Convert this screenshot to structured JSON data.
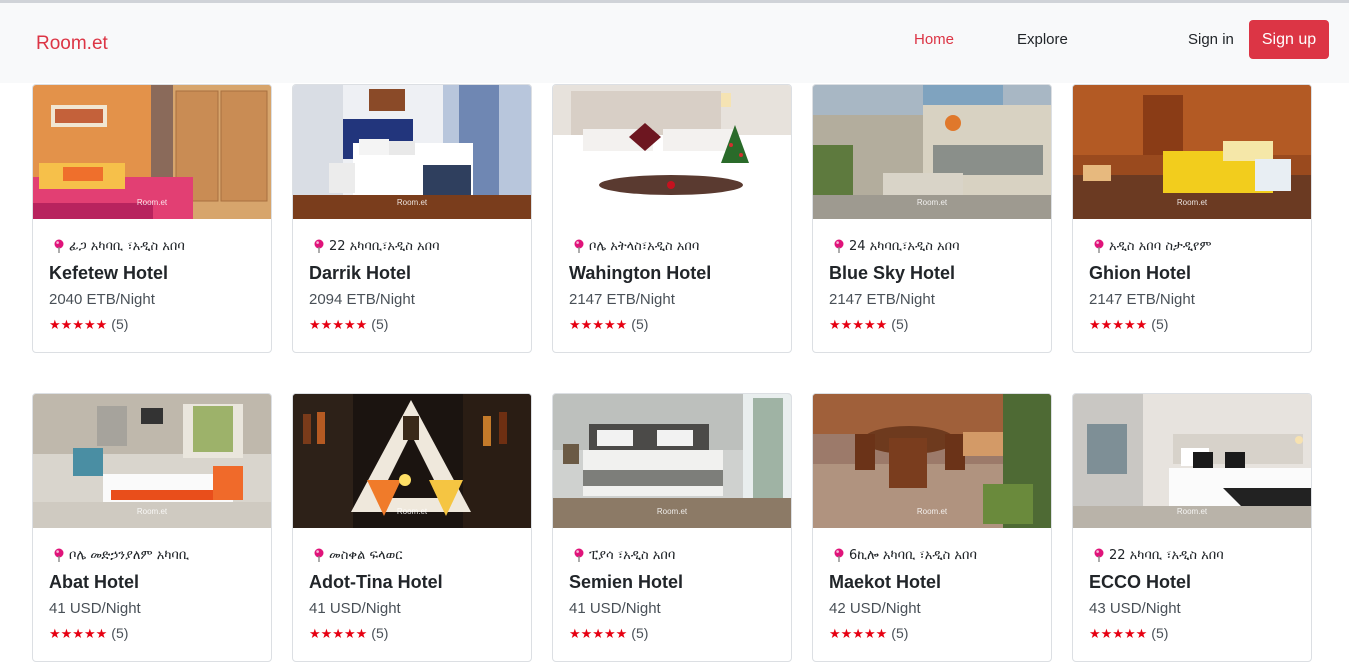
{
  "navbar": {
    "brand": "Room.et",
    "home_label": "Home",
    "explore_label": "Explore",
    "signin_label": "Sign in",
    "signup_label": "Sign up"
  },
  "colors": {
    "accent": "#dc3545",
    "star": "#e60012",
    "pin": "#e0137a"
  },
  "watermark": "Room.et",
  "hotels": [
    {
      "location": "ፊጋ አካባቢ ፣አዲስ አበባ",
      "name": "Kefetew Hotel",
      "price": "2040 ETB/Night",
      "stars": "★★★★★",
      "rating_count": "(5)",
      "image": "orange-bedroom"
    },
    {
      "location": "22 አካባቢ፣አዲስ አበባ",
      "name": "Darrik Hotel",
      "price": "2094 ETB/Night",
      "stars": "★★★★★",
      "rating_count": "(5)",
      "image": "blue-bedroom"
    },
    {
      "location": "ቦሌ አትላስ፣አዲስ አበባ",
      "name": "Wahington Hotel",
      "price": "2147 ETB/Night",
      "stars": "★★★★★",
      "rating_count": "(5)",
      "image": "white-bed-christmas"
    },
    {
      "location": "24 አካባቢ፣አዲስ አበባ",
      "name": "Blue Sky Hotel",
      "price": "2147 ETB/Night",
      "stars": "★★★★★",
      "rating_count": "(5)",
      "image": "building-exterior"
    },
    {
      "location": "አዲስ አበባ ስታዲየም",
      "name": "Ghion Hotel",
      "price": "2147 ETB/Night",
      "stars": "★★★★★",
      "rating_count": "(5)",
      "image": "wood-room-yellow-bed"
    },
    {
      "location": "ቦሌ መድኃንያለም አካባቢ",
      "name": "Abat Hotel",
      "price": "41 USD/Night",
      "stars": "★★★★★",
      "rating_count": "(5)",
      "image": "suite-red-pillows"
    },
    {
      "location": "መስቀል ፍላወር",
      "name": "Adot-Tina Hotel",
      "price": "41 USD/Night",
      "stars": "★★★★★",
      "rating_count": "(5)",
      "image": "bar-cocktails"
    },
    {
      "location": "ፒያሳ ፣አዲስ አበባ",
      "name": "Semien Hotel",
      "price": "41 USD/Night",
      "stars": "★★★★★",
      "rating_count": "(5)",
      "image": "grey-bedroom"
    },
    {
      "location": "6ኪሎ አካባቢ ፣አዲስ አበባ",
      "name": "Maekot Hotel",
      "price": "42 USD/Night",
      "stars": "★★★★★",
      "rating_count": "(5)",
      "image": "dining-terrace"
    },
    {
      "location": "22 አካባቢ ፣አዲስ አበባ",
      "name": "ECCO Hotel",
      "price": "43 USD/Night",
      "stars": "★★★★★",
      "rating_count": "(5)",
      "image": "modern-bedroom"
    }
  ]
}
